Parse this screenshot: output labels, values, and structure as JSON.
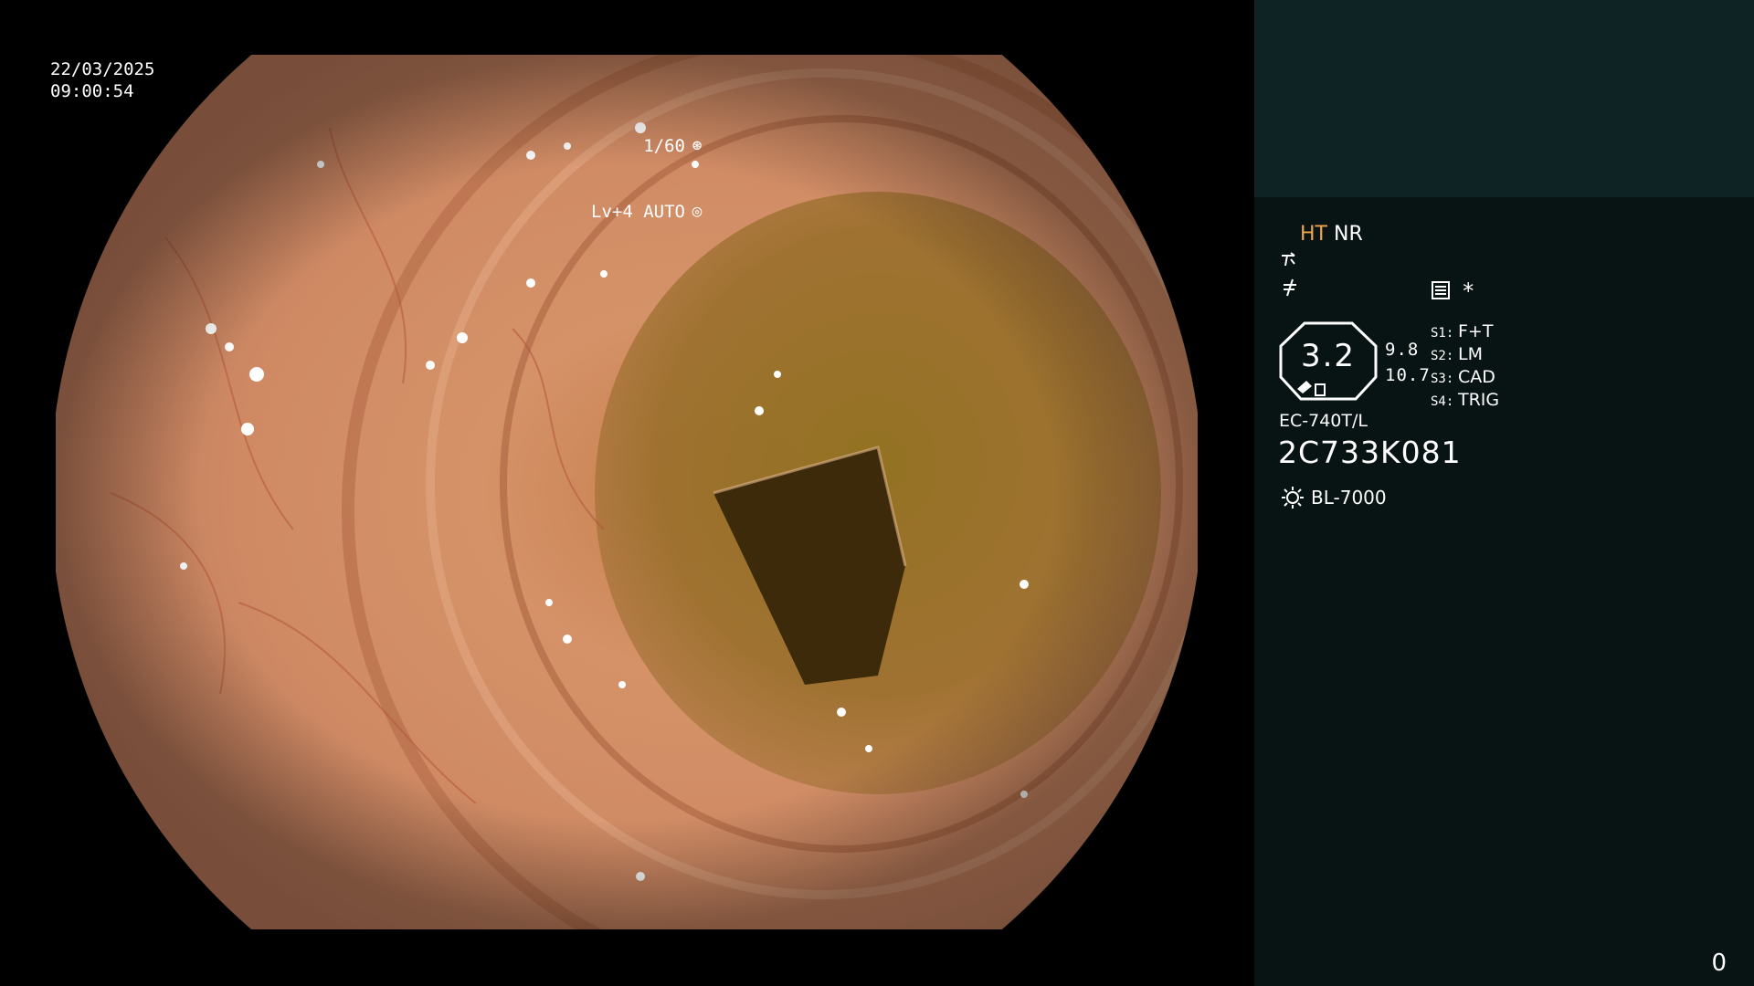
{
  "video": {
    "date": "22/03/2025",
    "time": "09:00:54",
    "shutter": "1/60",
    "shutter_icon": "aperture-icon",
    "level": "Lv+4 AUTO",
    "level_icon": "iris-icon"
  },
  "panel": {
    "mode_ht": "HT",
    "mode_nr": "NR",
    "colors": {
      "ht": "#f0a64a",
      "panel_bg": "#081313",
      "panel_top_bg": "#0d2324"
    },
    "icons": [
      "structure-enhance-icon",
      "contrast-icon",
      "memory-card-icon"
    ],
    "star": "*",
    "zoom_value": "3.2",
    "values": [
      "9.8",
      "10.7"
    ],
    "switches": [
      {
        "key": "S1:",
        "value": "F+T"
      },
      {
        "key": "S2:",
        "value": "LM"
      },
      {
        "key": "S3:",
        "value": "CAD"
      },
      {
        "key": "S4:",
        "value": "TRIG"
      }
    ],
    "scope_model": "EC-740T/L",
    "serial": "2C733K081",
    "light_source": "BL-7000",
    "light_icon": "lamp-icon",
    "counter": "0"
  }
}
